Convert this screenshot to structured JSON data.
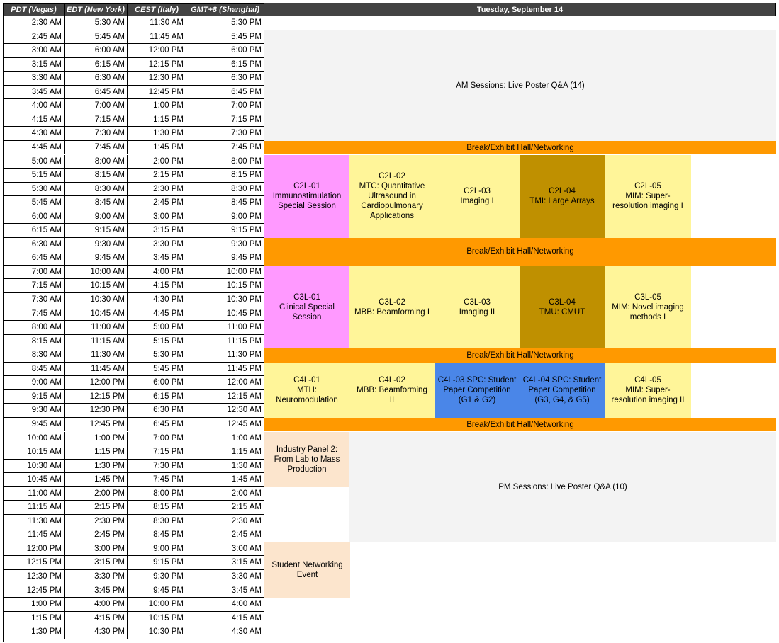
{
  "headers": {
    "pdt": "PDT (Vegas)",
    "edt": "EDT (New York)",
    "cest": "CEST (Italy)",
    "gmt": "GMT+8 (Shanghai)",
    "day": "Tuesday, September 14"
  },
  "times": [
    [
      "2:30 AM",
      "5:30 AM",
      "11:30 AM",
      "5:30 PM"
    ],
    [
      "2:45 AM",
      "5:45 AM",
      "11:45 AM",
      "5:45 PM"
    ],
    [
      "3:00 AM",
      "6:00 AM",
      "12:00 PM",
      "6:00 PM"
    ],
    [
      "3:15 AM",
      "6:15 AM",
      "12:15 PM",
      "6:15 PM"
    ],
    [
      "3:30 AM",
      "6:30 AM",
      "12:30 PM",
      "6:30 PM"
    ],
    [
      "3:45 AM",
      "6:45 AM",
      "12:45 PM",
      "6:45 PM"
    ],
    [
      "4:00 AM",
      "7:00 AM",
      "1:00 PM",
      "7:00 PM"
    ],
    [
      "4:15 AM",
      "7:15 AM",
      "1:15 PM",
      "7:15 PM"
    ],
    [
      "4:30 AM",
      "7:30 AM",
      "1:30 PM",
      "7:30 PM"
    ],
    [
      "4:45 AM",
      "7:45 AM",
      "1:45 PM",
      "7:45 PM"
    ],
    [
      "5:00 AM",
      "8:00 AM",
      "2:00 PM",
      "8:00 PM"
    ],
    [
      "5:15 AM",
      "8:15 AM",
      "2:15 PM",
      "8:15 PM"
    ],
    [
      "5:30 AM",
      "8:30 AM",
      "2:30 PM",
      "8:30 PM"
    ],
    [
      "5:45 AM",
      "8:45 AM",
      "2:45 PM",
      "8:45 PM"
    ],
    [
      "6:00 AM",
      "9:00 AM",
      "3:00 PM",
      "9:00 PM"
    ],
    [
      "6:15 AM",
      "9:15 AM",
      "3:15 PM",
      "9:15 PM"
    ],
    [
      "6:30 AM",
      "9:30 AM",
      "3:30 PM",
      "9:30 PM"
    ],
    [
      "6:45 AM",
      "9:45 AM",
      "3:45 PM",
      "9:45 PM"
    ],
    [
      "7:00 AM",
      "10:00 AM",
      "4:00 PM",
      "10:00 PM"
    ],
    [
      "7:15 AM",
      "10:15 AM",
      "4:15 PM",
      "10:15 PM"
    ],
    [
      "7:30 AM",
      "10:30 AM",
      "4:30 PM",
      "10:30 PM"
    ],
    [
      "7:45 AM",
      "10:45 AM",
      "4:45 PM",
      "10:45 PM"
    ],
    [
      "8:00 AM",
      "11:00 AM",
      "5:00 PM",
      "11:00 PM"
    ],
    [
      "8:15 AM",
      "11:15 AM",
      "5:15 PM",
      "11:15 PM"
    ],
    [
      "8:30 AM",
      "11:30 AM",
      "5:30 PM",
      "11:30 PM"
    ],
    [
      "8:45 AM",
      "11:45 AM",
      "5:45 PM",
      "11:45 PM"
    ],
    [
      "9:00 AM",
      "12:00 PM",
      "6:00 PM",
      "12:00 AM"
    ],
    [
      "9:15 AM",
      "12:15 PM",
      "6:15 PM",
      "12:15 AM"
    ],
    [
      "9:30 AM",
      "12:30 PM",
      "6:30 PM",
      "12:30 AM"
    ],
    [
      "9:45 AM",
      "12:45 PM",
      "6:45 PM",
      "12:45 AM"
    ],
    [
      "10:00 AM",
      "1:00 PM",
      "7:00 PM",
      "1:00 AM"
    ],
    [
      "10:15 AM",
      "1:15 PM",
      "7:15 PM",
      "1:15 AM"
    ],
    [
      "10:30 AM",
      "1:30 PM",
      "7:30 PM",
      "1:30 AM"
    ],
    [
      "10:45 AM",
      "1:45 PM",
      "7:45 PM",
      "1:45 AM"
    ],
    [
      "11:00 AM",
      "2:00 PM",
      "8:00 PM",
      "2:00 AM"
    ],
    [
      "11:15 AM",
      "2:15 PM",
      "8:15 PM",
      "2:15 AM"
    ],
    [
      "11:30 AM",
      "2:30 PM",
      "8:30 PM",
      "2:30 AM"
    ],
    [
      "11:45 AM",
      "2:45 PM",
      "8:45 PM",
      "2:45 AM"
    ],
    [
      "12:00 PM",
      "3:00 PM",
      "9:00 PM",
      "3:00 AM"
    ],
    [
      "12:15 PM",
      "3:15 PM",
      "9:15 PM",
      "3:15 AM"
    ],
    [
      "12:30 PM",
      "3:30 PM",
      "9:30 PM",
      "3:30 AM"
    ],
    [
      "12:45 PM",
      "3:45 PM",
      "9:45 PM",
      "3:45 AM"
    ],
    [
      "1:00 PM",
      "4:00 PM",
      "10:00 PM",
      "4:00 AM"
    ],
    [
      "1:15 PM",
      "4:15 PM",
      "10:15 PM",
      "4:15 AM"
    ],
    [
      "1:30 PM",
      "4:30 PM",
      "10:30 PM",
      "4:30 AM"
    ]
  ],
  "sessions": {
    "am_poster": "AM Sessions: Live Poster Q&A (14)",
    "break_label": "Break/Exhibit Hall/Networking",
    "c2l01": [
      "C2L-01",
      "Immunostimulation",
      "Special Session"
    ],
    "c2l02": [
      "C2L-02",
      "MTC: Quantitative",
      "Ultrasound in",
      "Cardiopulmonary",
      "Applications"
    ],
    "c2l03": [
      "C2L-03",
      "Imaging I"
    ],
    "c2l04": [
      "C2L-04",
      "TMI: Large Arrays"
    ],
    "c2l05": [
      "C2L-05",
      "MIM: Super-",
      "resolution imaging I"
    ],
    "c3l01": [
      "C3L-01",
      "Clinical Special",
      "Session"
    ],
    "c3l02": [
      "C3L-02",
      "MBB: Beamforming I"
    ],
    "c3l03": [
      "C3L-03",
      "Imaging II"
    ],
    "c3l04": [
      "C3L-04",
      "TMU: CMUT"
    ],
    "c3l05": [
      "C3L-05",
      "MIM: Novel imaging",
      "methods I"
    ],
    "c4l01": [
      "C4L-01",
      "MTH:",
      "Neuromodulation"
    ],
    "c4l02": [
      "C4L-02",
      "MBB: Beamforming",
      "II"
    ],
    "c4l03": [
      "C4L-03 SPC: Student",
      "Paper Competition",
      "(G1 & G2)"
    ],
    "c4l04": [
      "C4L-04 SPC: Student",
      "Paper Competition",
      "(G3, G4, & G5)"
    ],
    "c4l05": [
      "C4L-05",
      "MIM: Super-",
      "resolution imaging II"
    ],
    "industry": [
      "Industry Panel 2:",
      "From Lab to Mass",
      "Production"
    ],
    "pm_poster": "PM Sessions: Live Poster Q&A (10)",
    "student": [
      "Student Networking",
      "Event"
    ]
  },
  "colors": {
    "header": "#434343",
    "break": "#ff9900",
    "poster": "#f3f3f3",
    "special": "#ff99ff",
    "oral": "#fff599",
    "tmi": "#bf9000",
    "spc": "#4a86e8",
    "industry": "#fce5cd"
  }
}
